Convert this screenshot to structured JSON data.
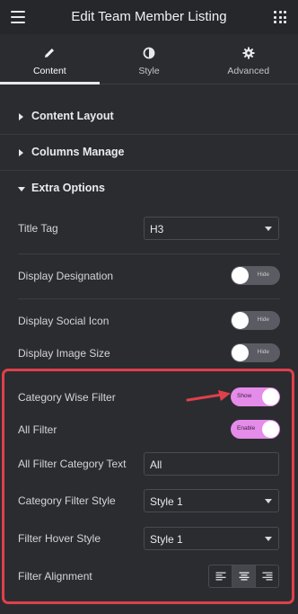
{
  "header": {
    "title": "Edit Team Member Listing",
    "menu_icon": "hamburger-menu-icon",
    "apps_icon": "grid-apps-icon"
  },
  "tabs": [
    {
      "label": "Content",
      "icon": "pencil-icon",
      "active": true
    },
    {
      "label": "Style",
      "icon": "half-circle-icon",
      "active": false
    },
    {
      "label": "Advanced",
      "icon": "gear-icon",
      "active": false
    }
  ],
  "sections": {
    "content_layout": "Content Layout",
    "columns_manage": "Columns Manage",
    "extra_options": "Extra Options"
  },
  "fields": {
    "title_tag": {
      "label": "Title Tag",
      "value": "H3"
    },
    "display_designation": {
      "label": "Display Designation",
      "toggle": "Hide"
    },
    "display_social_icon": {
      "label": "Display Social Icon",
      "toggle": "Hide"
    },
    "display_image_size": {
      "label": "Display Image Size",
      "toggle": "Hide"
    },
    "category_wise_filter": {
      "label": "Category Wise Filter",
      "toggle": "Show"
    },
    "all_filter": {
      "label": "All Filter",
      "toggle": "Enable"
    },
    "all_filter_category_text": {
      "label": "All Filter Category Text",
      "value": "All"
    },
    "category_filter_style": {
      "label": "Category Filter Style",
      "value": "Style 1"
    },
    "filter_hover_style": {
      "label": "Filter Hover Style",
      "value": "Style 1"
    },
    "filter_alignment": {
      "label": "Filter Alignment",
      "options": [
        "align-left-icon",
        "align-center-icon",
        "align-right-icon"
      ],
      "selected": "center"
    }
  },
  "colors": {
    "accent_toggle": "#e58be9",
    "annotation": "#e0404a",
    "panel_bg": "#2b2c30"
  }
}
